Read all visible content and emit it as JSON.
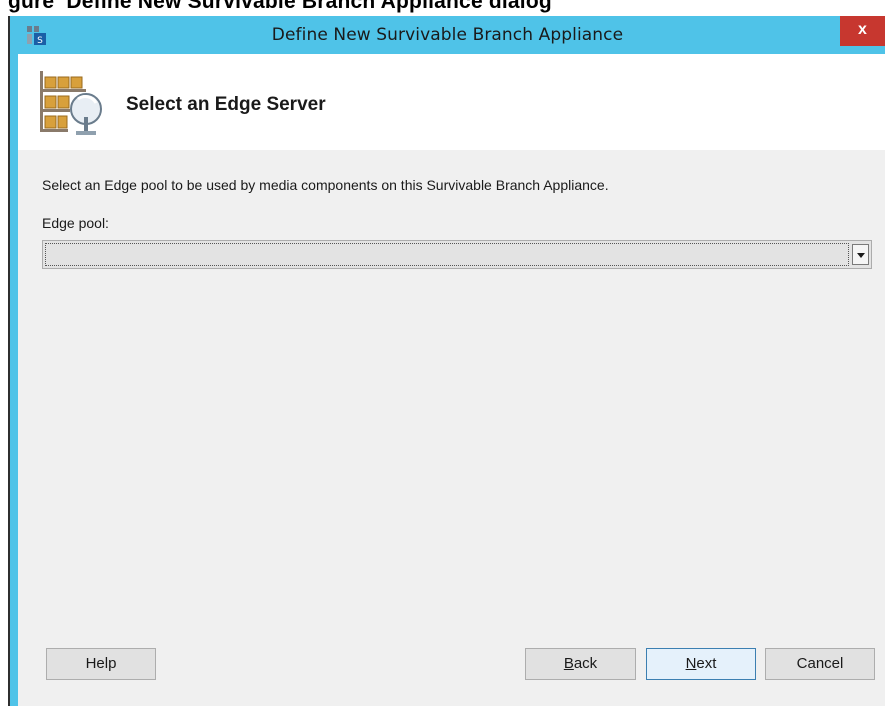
{
  "caption": "gure  Define New Survivable Branch Appliance dialog",
  "window": {
    "title": "Define New Survivable Branch Appliance",
    "close_label": "x"
  },
  "header": {
    "title": "Select an Edge Server"
  },
  "content": {
    "instruction": "Select an Edge pool to be used by media components on this Survivable Branch Appliance.",
    "edge_pool_label": "Edge pool:",
    "edge_pool_value": ""
  },
  "buttons": {
    "help": "Help",
    "back_mnemonic": "B",
    "back_rest": "ack",
    "next_mnemonic": "N",
    "next_rest": "ext",
    "cancel": "Cancel"
  },
  "icons": {
    "app": "lync-topology-icon",
    "header": "branch-appliance-server-icon",
    "close": "close-icon",
    "dropdown": "chevron-down-icon"
  }
}
